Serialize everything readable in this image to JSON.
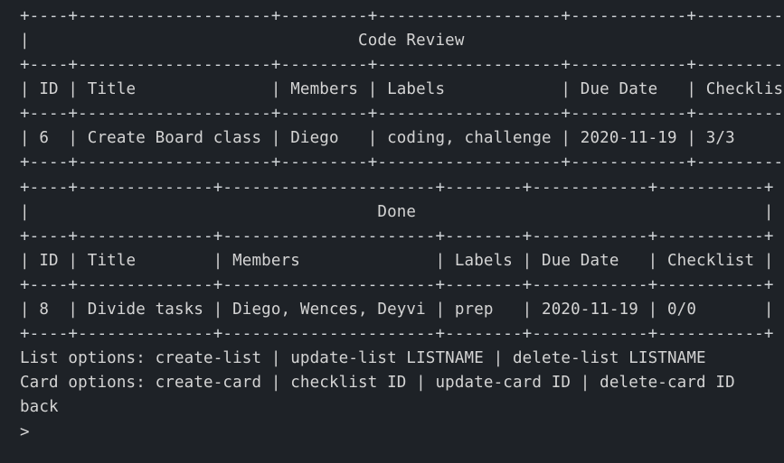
{
  "terminal": {
    "lines": [
      "+----+--------------------+---------+-------------------+------------+-----------+",
      "|                                  Code Review                                    |",
      "+----+--------------------+---------+-------------------+------------+-----------+",
      "| ID | Title              | Members | Labels            | Due Date   | Checklist |",
      "+----+--------------------+---------+-------------------+------------+-----------+",
      "| 6  | Create Board class | Diego   | coding, challenge | 2020-11-19 | 3/3       |",
      "+----+--------------------+---------+-------------------+------------+-----------+",
      "+----+--------------+----------------------+--------+------------+-----------+",
      "|                                    Done                                    |",
      "+----+--------------+----------------------+--------+------------+-----------+",
      "| ID | Title        | Members              | Labels | Due Date   | Checklist |",
      "+----+--------------+----------------------+--------+------------+-----------+",
      "| 8  | Divide tasks | Diego, Wences, Deyvi | prep   | 2020-11-19 | 0/0       |",
      "+----+--------------+----------------------+--------+------------+-----------+",
      "List options: create-list | update-list LISTNAME | delete-list LISTNAME",
      "Card options: create-card | checklist ID | update-card ID | delete-card ID",
      "back",
      ">"
    ]
  }
}
